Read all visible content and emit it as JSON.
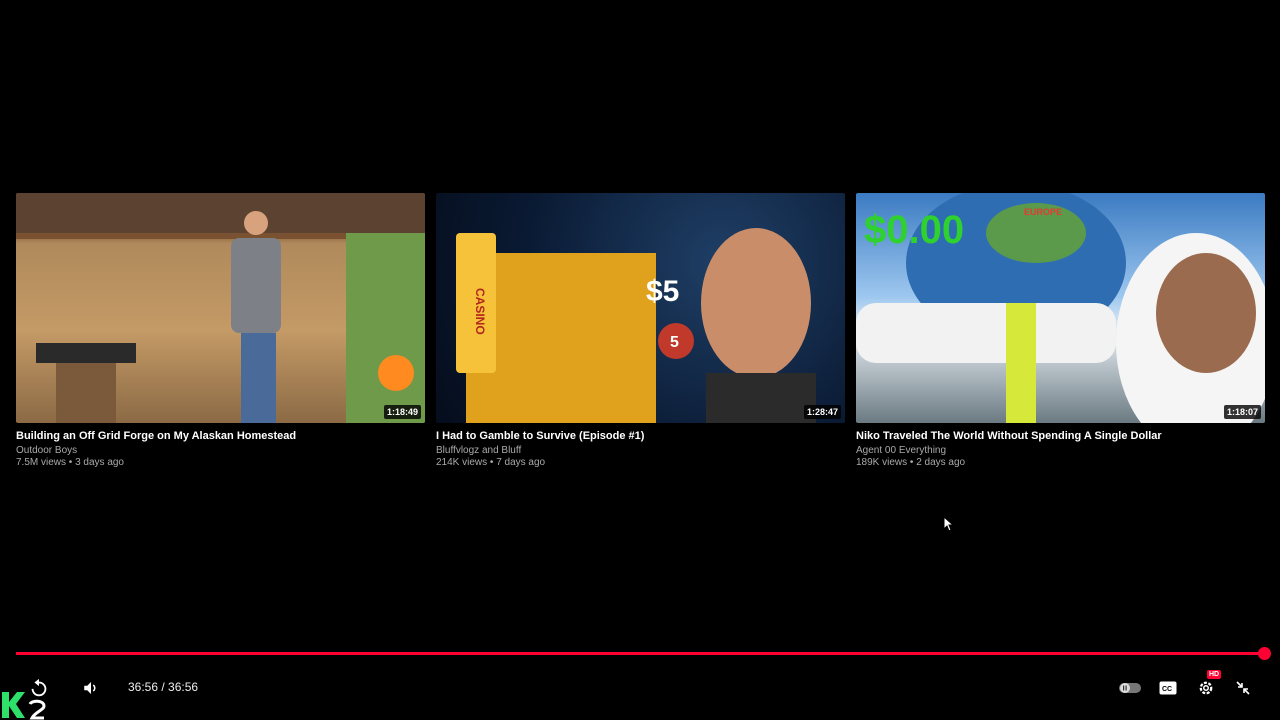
{
  "endscreen": {
    "cards": [
      {
        "title": "Building an Off Grid Forge on My Alaskan Homestead",
        "channel": "Outdoor Boys",
        "stats": "7.5M views • 3 days ago",
        "duration": "1:18:49"
      },
      {
        "title": "I Had to Gamble to Survive (Episode #1)",
        "channel": "Bluffvlogz and Bluff",
        "stats": "214K views • 7 days ago",
        "duration": "1:28:47",
        "thumb_text": {
          "price": "$5",
          "sign": "CASINO",
          "chip": "5"
        }
      },
      {
        "title": "Niko Traveled The World Without Spending A Single Dollar",
        "channel": "Agent 00 Everything",
        "stats": "189K views • 2 days ago",
        "duration": "1:18:07",
        "thumb_text": {
          "amount": "$0.00",
          "region": "EUROPE"
        }
      }
    ]
  },
  "player": {
    "progress_fraction": 1.0,
    "time_display": "36:56 / 36:56",
    "settings_badge": "HD",
    "accent_color": "#ff0033"
  },
  "icons": [
    "replay-icon",
    "volume-icon",
    "autoplay-toggle-icon",
    "captions-icon",
    "settings-icon",
    "exit-fullscreen-icon",
    "cursor-icon"
  ]
}
